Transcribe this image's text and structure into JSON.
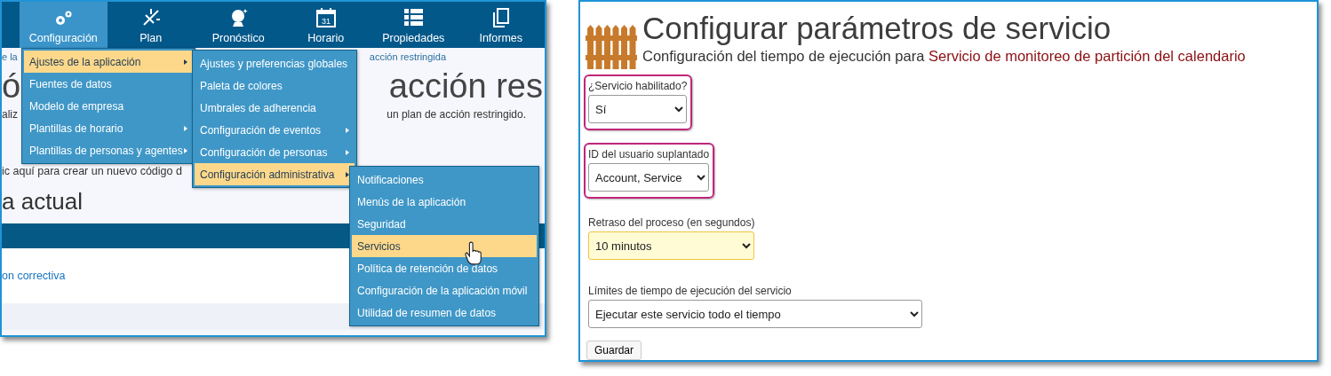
{
  "left_screen": {
    "nav": [
      {
        "label": "Configuración",
        "selected": true
      },
      {
        "label": "Plan",
        "selected": false
      },
      {
        "label": "Pronóstico",
        "selected": false
      },
      {
        "label": "Horario",
        "icon_text": "31",
        "selected": false
      },
      {
        "label": "Propiedades",
        "selected": false
      },
      {
        "label": "Informes",
        "selected": false
      }
    ],
    "background": {
      "breadcrumb_start": "e la",
      "breadcrumb_end": "acción restringida",
      "heading_start": "ó",
      "heading_end": "acción res",
      "intro_start": "aliz",
      "intro_end": "un plan de acción restringido.",
      "create_text": "ic aquí para crear un nuevo código d",
      "section_heading": "a actual",
      "row_link": "on correctiva"
    },
    "menus": [
      {
        "items": [
          {
            "label": "Ajustes de la aplicación",
            "submenu": true,
            "selected": true
          },
          {
            "label": "Fuentes de datos",
            "submenu": false,
            "selected": false
          },
          {
            "label": "Modelo de empresa",
            "submenu": false,
            "selected": false
          },
          {
            "label": "Plantillas de horario",
            "submenu": true,
            "selected": false
          },
          {
            "label": "Plantillas de personas y agentes",
            "submenu": true,
            "selected": false
          }
        ]
      },
      {
        "items": [
          {
            "label": "Ajustes y preferencias globales",
            "submenu": false,
            "selected": false
          },
          {
            "label": "Paleta de colores",
            "submenu": false,
            "selected": false
          },
          {
            "label": "Umbrales de adherencia",
            "submenu": false,
            "selected": false
          },
          {
            "label": "Configuración de eventos",
            "submenu": true,
            "selected": false
          },
          {
            "label": "Configuración de personas",
            "submenu": true,
            "selected": false
          },
          {
            "label": "Configuración administrativa",
            "submenu": true,
            "selected": true
          }
        ]
      },
      {
        "items": [
          {
            "label": "Notificaciones",
            "submenu": false,
            "selected": false
          },
          {
            "label": "Menús de la aplicación",
            "submenu": false,
            "selected": false
          },
          {
            "label": "Seguridad",
            "submenu": false,
            "selected": false
          },
          {
            "label": "Servicios",
            "submenu": false,
            "selected": true
          },
          {
            "label": "Política de retención de datos",
            "submenu": false,
            "selected": false
          },
          {
            "label": "Configuración de la aplicación móvil",
            "submenu": false,
            "selected": false
          },
          {
            "label": "Utilidad de resumen de datos",
            "submenu": false,
            "selected": false
          }
        ]
      }
    ]
  },
  "right_screen": {
    "title": "Configurar parámetros de servicio",
    "subtitle": "Configuración del tiempo de ejecución para ",
    "service_name": "Servicio de monitoreo de partición del calendario",
    "fields": [
      {
        "label": "¿Servicio habilitado?",
        "value": "Sí",
        "highlighted": true,
        "modified": false,
        "wide": false
      },
      {
        "label": "ID del usuario suplantado",
        "value": "Account, Service",
        "highlighted": true,
        "modified": false,
        "wide": false
      },
      {
        "label": "Retraso del proceso (en segundos)",
        "value": "10 minutos",
        "highlighted": false,
        "modified": true,
        "wide": false
      },
      {
        "label": "Límites de tiempo de ejecución del servicio",
        "value": "Ejecutar este servicio todo el tiempo",
        "highlighted": false,
        "modified": false,
        "wide": true
      }
    ],
    "save_button": "Guardar"
  }
}
